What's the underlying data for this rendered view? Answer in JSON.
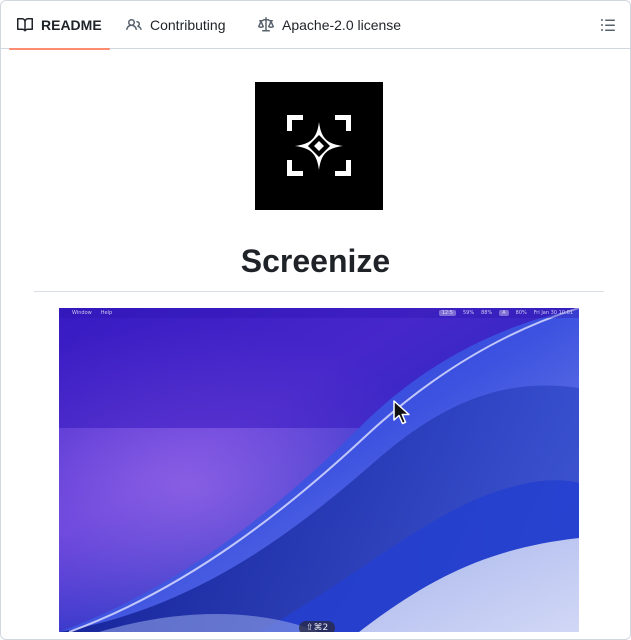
{
  "tabs": [
    {
      "label": "README",
      "icon": "book-icon",
      "active": true
    },
    {
      "label": "Contributing",
      "icon": "people-icon",
      "active": false
    },
    {
      "label": "Apache-2.0 license",
      "icon": "law-icon",
      "active": false
    }
  ],
  "outline_button": {
    "icon": "list-unordered-icon"
  },
  "readme": {
    "title": "Screenize",
    "logo_icon": "screenize-logo-icon"
  },
  "screenshot": {
    "menu_left": [
      "",
      "Window",
      "Help"
    ],
    "menu_right": [
      "12:5",
      "59%",
      "88%",
      "A",
      "80%",
      "Fri Jan 30  10:01"
    ],
    "shortcut_badge": "⇧⌘2"
  },
  "colors": {
    "active_tab_underline": "#fd8c73",
    "text": "#1f2328",
    "muted_icon": "#59636e",
    "border": "#d0d7de"
  }
}
